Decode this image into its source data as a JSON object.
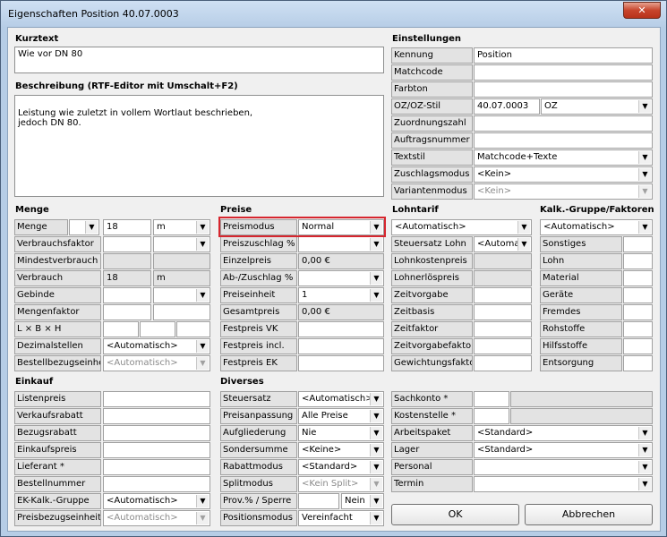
{
  "window": {
    "title": "Eigenschaften Position 40.07.0003",
    "close_icon": "close-icon"
  },
  "kurztext": {
    "heading": "Kurztext",
    "value": "Wie vor DN 80"
  },
  "beschreibung": {
    "heading": "Beschreibung (RTF-Editor mit Umschalt+F2)",
    "value": "Leistung wie zuletzt in vollem Wortlaut beschrieben,\njedoch DN 80."
  },
  "einstellungen": {
    "heading": "Einstellungen",
    "rows": [
      {
        "label": "Kennung",
        "value": "Position"
      },
      {
        "label": "Matchcode",
        "value": ""
      },
      {
        "label": "Farbton",
        "value": ""
      },
      {
        "label": "OZ/OZ-Stil",
        "value": "40.07.0003",
        "value2": "OZ"
      },
      {
        "label": "Zuordnungszahl",
        "value": ""
      },
      {
        "label": "Auftragsnummer",
        "value": ""
      },
      {
        "label": "Textstil",
        "value": "Matchcode+Texte"
      },
      {
        "label": "Zuschlagsmodus",
        "value": "<Kein>"
      },
      {
        "label": "Variantenmodus",
        "value": "<Kein>"
      }
    ]
  },
  "menge": {
    "heading": "Menge",
    "rows": [
      {
        "label": "Menge",
        "value": "18",
        "unit": "m"
      },
      {
        "label": "Verbrauchsfaktor",
        "value": ""
      },
      {
        "label": "Mindestverbrauch",
        "value": ""
      },
      {
        "label": "Verbrauch",
        "value": "18",
        "unit": "m"
      },
      {
        "label": "Gebinde",
        "value": ""
      },
      {
        "label": "Mengenfaktor",
        "value": ""
      },
      {
        "label": "L × B × H",
        "value": ""
      },
      {
        "label": "Dezimalstellen",
        "value": "<Automatisch>"
      },
      {
        "label": "Bestellbezugseinheit",
        "value": "<Automatisch>"
      }
    ]
  },
  "preise": {
    "heading": "Preise",
    "rows": [
      {
        "label": "Preismodus",
        "value": "Normal"
      },
      {
        "label": "Preiszuschlag %",
        "value": ""
      },
      {
        "label": "Einzelpreis",
        "value": "0,00 €"
      },
      {
        "label": "Ab-/Zuschlag %",
        "value": ""
      },
      {
        "label": "Preiseinheit",
        "value": "1"
      },
      {
        "label": "Gesamtpreis",
        "value": "0,00 €"
      },
      {
        "label": "Festpreis VK",
        "value": ""
      },
      {
        "label": "Festpreis incl.",
        "value": ""
      },
      {
        "label": "Festpreis EK",
        "value": ""
      }
    ]
  },
  "lohntarif": {
    "heading": "Lohntarif",
    "top": "<Automatisch>",
    "rows": [
      {
        "label": "Steuersatz Lohn",
        "value": "<Automat"
      },
      {
        "label": "Lohnkostenpreis",
        "value": ""
      },
      {
        "label": "Lohnerlöspreis",
        "value": ""
      },
      {
        "label": "Zeitvorgabe",
        "value": ""
      },
      {
        "label": "Zeitbasis",
        "value": ""
      },
      {
        "label": "Zeitfaktor",
        "value": ""
      },
      {
        "label": "Zeitvorgabefaktor",
        "value": ""
      },
      {
        "label": "Gewichtungsfaktor",
        "value": ""
      }
    ]
  },
  "kalk": {
    "heading": "Kalk.-Gruppe/Faktoren",
    "top": "<Automatisch>",
    "rows": [
      {
        "label": "Sonstiges",
        "value": ""
      },
      {
        "label": "Lohn",
        "value": ""
      },
      {
        "label": "Material",
        "value": ""
      },
      {
        "label": "Geräte",
        "value": ""
      },
      {
        "label": "Fremdes",
        "value": ""
      },
      {
        "label": "Rohstoffe",
        "value": ""
      },
      {
        "label": "Hilfsstoffe",
        "value": ""
      },
      {
        "label": "Entsorgung",
        "value": ""
      }
    ]
  },
  "einkauf": {
    "heading": "Einkauf",
    "rows": [
      {
        "label": "Listenpreis",
        "value": ""
      },
      {
        "label": "Verkaufsrabatt",
        "value": ""
      },
      {
        "label": "Bezugsrabatt",
        "value": ""
      },
      {
        "label": "Einkaufspreis",
        "value": ""
      },
      {
        "label": "Lieferant *",
        "value": ""
      },
      {
        "label": "Bestellnummer",
        "value": ""
      },
      {
        "label": "EK-Kalk.-Gruppe",
        "value": "<Automatisch>"
      },
      {
        "label": "Preisbezugseinheit",
        "value": "<Automatisch>"
      }
    ]
  },
  "diverses": {
    "heading": "Diverses",
    "rows": [
      {
        "label": "Steuersatz",
        "value": "<Automatisch>"
      },
      {
        "label": "Preisanpassung",
        "value": "Alle Preise"
      },
      {
        "label": "Aufgliederung",
        "value": "Nie"
      },
      {
        "label": "Sondersumme",
        "value": "<Keine>"
      },
      {
        "label": "Rabattmodus",
        "value": "<Standard>"
      },
      {
        "label": "Splitmodus",
        "value": "<Kein Split>"
      },
      {
        "label": "Prov.% / Sperre",
        "value": "",
        "value2": "Nein"
      },
      {
        "label": "Positionsmodus",
        "value": "Vereinfacht"
      }
    ]
  },
  "misc": {
    "rows": [
      {
        "label": "Sachkonto *",
        "value": ""
      },
      {
        "label": "Kostenstelle *",
        "value": ""
      },
      {
        "label": "Arbeitspaket",
        "value": "<Standard>"
      },
      {
        "label": "Lager",
        "value": "<Standard>"
      },
      {
        "label": "Personal",
        "value": ""
      },
      {
        "label": "Termin",
        "value": ""
      }
    ]
  },
  "buttons": {
    "ok": "OK",
    "cancel": "Abbrechen"
  }
}
